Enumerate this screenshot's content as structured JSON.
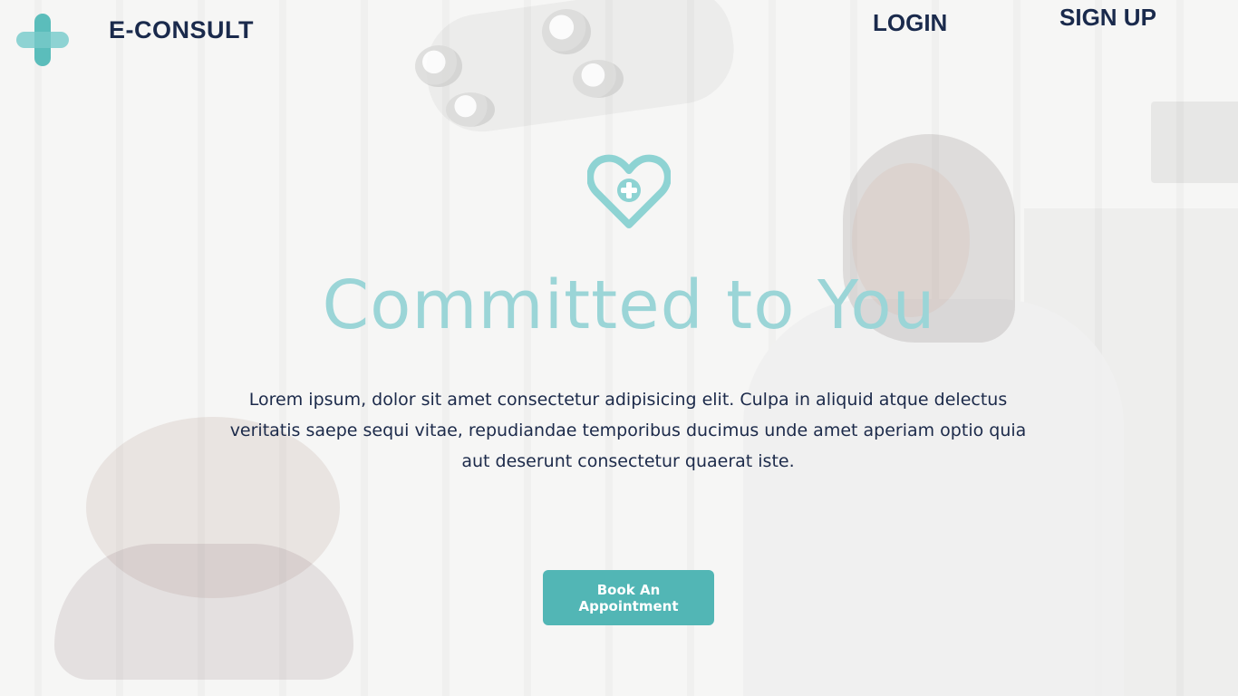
{
  "brand": {
    "name": "E-CONSULT",
    "accent_color": "#52b6b5"
  },
  "nav": {
    "login_label": "LOGIN",
    "signup_label": "SIGN UP"
  },
  "hero": {
    "icon": "heart-plus-icon",
    "title": "Committed to You",
    "description": "Lorem ipsum, dolor sit amet consectetur adipisicing elit. Culpa in aliquid atque delectus veritatis saepe sequi vitae, repudiandae temporibus ducimus unde amet aperiam optio quia aut deserunt consectetur quaerat iste.",
    "cta_label": "Book An Appointment",
    "title_color": "#9bd5d7",
    "text_color": "#1c2a4a"
  }
}
